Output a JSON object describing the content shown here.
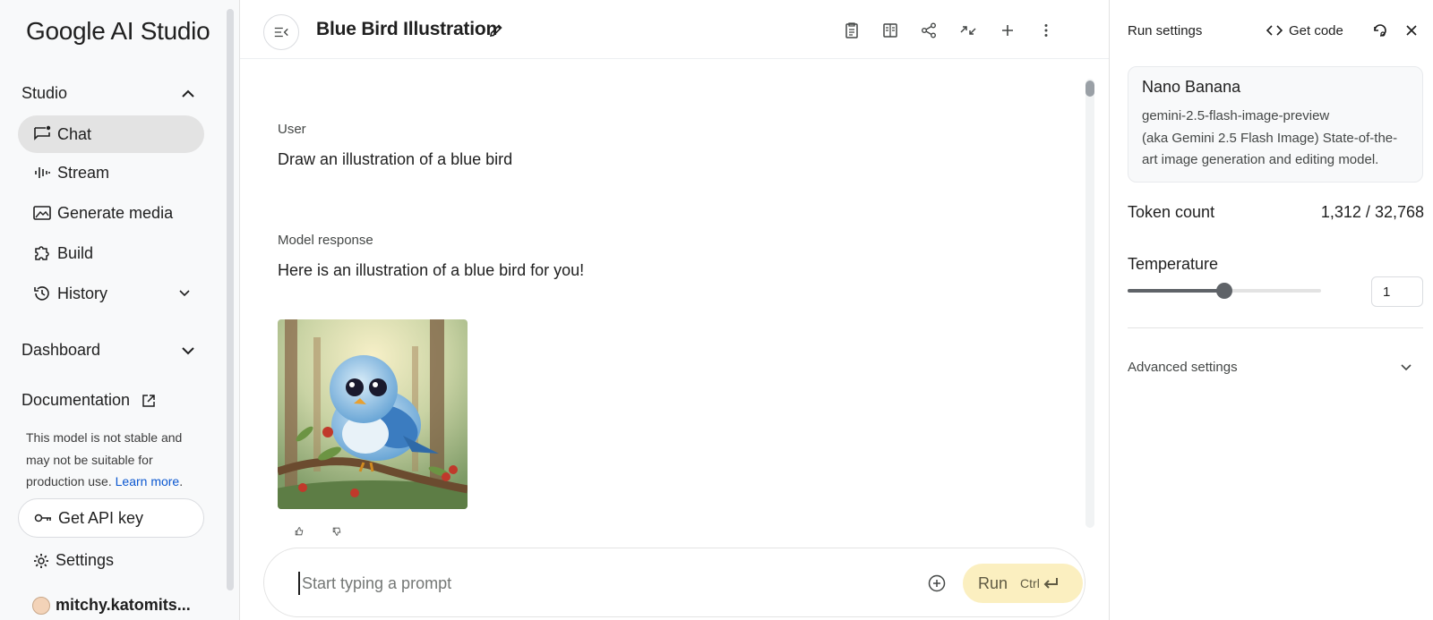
{
  "sidebar": {
    "logo": "Google AI Studio",
    "studio_label": "Studio",
    "items": [
      {
        "label": "Chat",
        "icon": "chat-icon"
      },
      {
        "label": "Stream",
        "icon": "waveform-icon"
      },
      {
        "label": "Generate media",
        "icon": "image-icon"
      },
      {
        "label": "Build",
        "icon": "puzzle-icon"
      },
      {
        "label": "History",
        "icon": "history-icon"
      }
    ],
    "dashboard_label": "Dashboard",
    "documentation_label": "Documentation",
    "note_text": "This model is not stable and may not be suitable for production use. ",
    "note_link": "Learn more",
    "note_end": ".",
    "api_key_label": "Get API key",
    "settings_label": "Settings",
    "user_label": "mitchy.katomits..."
  },
  "header": {
    "title": "Blue Bird Illustration"
  },
  "conversation": {
    "user_label": "User",
    "user_text": "Draw an illustration of a blue bird",
    "model_label": "Model response",
    "model_text": "Here is an illustration of a blue bird for you!"
  },
  "prompt": {
    "placeholder": "Start typing a prompt",
    "run_label": "Run",
    "shortcut": "Ctrl"
  },
  "run_settings": {
    "title": "Run settings",
    "get_code_label": "Get code",
    "model": {
      "name": "Nano Banana",
      "id": "gemini-2.5-flash-image-preview",
      "description": "(aka Gemini 2.5 Flash Image) State-of-the-art image generation and editing model."
    },
    "token_count_label": "Token count",
    "token_count_value": "1,312 / 32,768",
    "temperature_label": "Temperature",
    "temperature_value": "1",
    "temperature_fraction": 0.5,
    "advanced_label": "Advanced settings"
  },
  "colors": {
    "accent_link": "#0b57d0",
    "run_button_bg": "#fbefc0",
    "active_nav_bg": "#e3e3e3"
  }
}
